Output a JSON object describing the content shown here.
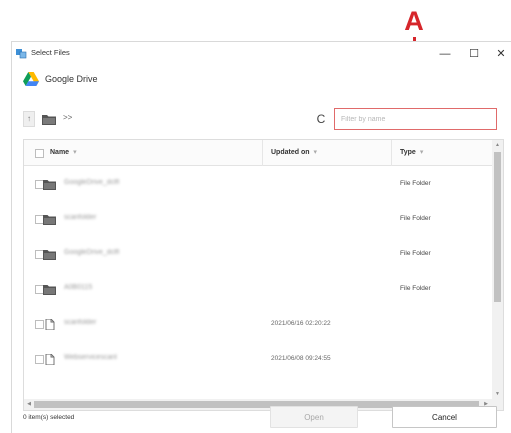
{
  "callout": {
    "label": "A",
    "color": "#d6262b"
  },
  "window": {
    "title": "Select Files",
    "controls": {
      "minimize": "—",
      "maximize": "☐",
      "close": "✕"
    }
  },
  "brand": {
    "name": "Google Drive",
    "icon": "google-drive-icon"
  },
  "toolbar": {
    "up_label": "↑",
    "breadcrumb_separator": ">>",
    "refresh_label": "C",
    "filter_placeholder": "Filter by name"
  },
  "table": {
    "columns": [
      {
        "label": "Name",
        "sort": "▾"
      },
      {
        "label": "Updated on",
        "sort": "▾"
      },
      {
        "label": "Type",
        "sort": "▾"
      }
    ],
    "rows": [
      {
        "icon": "folder-icon",
        "name": "GoogleDrive_dclfl",
        "updated": "",
        "type": "File Folder"
      },
      {
        "icon": "folder-icon",
        "name": "scanfolder",
        "updated": "",
        "type": "File Folder"
      },
      {
        "icon": "folder-icon",
        "name": "GoogleDrive_dclfl",
        "updated": "",
        "type": "File Folder"
      },
      {
        "icon": "folder-icon",
        "name": "A0B0115",
        "updated": "",
        "type": "File Folder"
      },
      {
        "icon": "file-icon",
        "name": "scanfolder",
        "updated": "2021/06/16 02:20:22",
        "type": ""
      },
      {
        "icon": "file-icon",
        "name": "Webservicescanl",
        "updated": "2021/06/08 09:24:55",
        "type": ""
      }
    ]
  },
  "footer": {
    "status": "0 item(s) selected",
    "open_label": "Open",
    "cancel_label": "Cancel"
  }
}
